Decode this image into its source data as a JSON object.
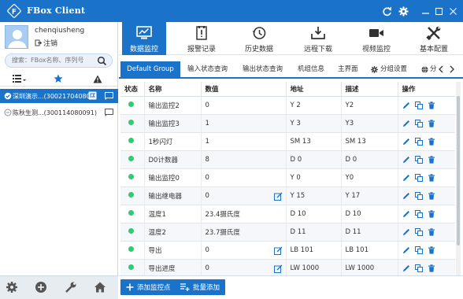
{
  "app": {
    "title": "FBox Client"
  },
  "user": {
    "name": "chenqiusheng",
    "logout_label": "注销"
  },
  "search": {
    "placeholder": "搜索：FBox名称、序列号"
  },
  "devices": [
    {
      "name": "深圳演示...(300217040800)",
      "online": true,
      "selected": true
    },
    {
      "name": "陈秋生测...(300114080091)",
      "online": false,
      "selected": false
    }
  ],
  "nav": {
    "tabs": [
      {
        "label": "数据监控",
        "icon": "monitor-icon",
        "active": true
      },
      {
        "label": "报警记录",
        "icon": "alarm-icon"
      },
      {
        "label": "历史数据",
        "icon": "history-icon"
      },
      {
        "label": "远程下载",
        "icon": "download-icon"
      },
      {
        "label": "视频监控",
        "icon": "video-icon"
      },
      {
        "label": "基本配置",
        "icon": "tools-icon"
      }
    ]
  },
  "groups": {
    "tabs": [
      "Default Group",
      "输入状态查询",
      "输出状态查询",
      "机组信息",
      "主界面",
      "分组设置",
      "分"
    ]
  },
  "table": {
    "headers": [
      "状态",
      "名称",
      "数值",
      "地址",
      "描述",
      "操作"
    ],
    "rows": [
      {
        "status": "online",
        "name": "输出监控2",
        "value": "0",
        "address": "Y 2",
        "desc": "Y2",
        "editable": false
      },
      {
        "status": "online",
        "name": "输出监控3",
        "value": "1",
        "address": "Y 3",
        "desc": "Y3",
        "editable": false
      },
      {
        "status": "online",
        "name": "1秒闪灯",
        "value": "1",
        "address": "SM 13",
        "desc": "SM 13",
        "editable": false
      },
      {
        "status": "online",
        "name": "D0计数器",
        "value": "8",
        "address": "D 0",
        "desc": "D 0",
        "editable": false
      },
      {
        "status": "online",
        "name": "输出监控0",
        "value": "0",
        "address": "Y 0",
        "desc": "Y0",
        "editable": false
      },
      {
        "status": "online",
        "name": "输出继电器",
        "value": "0",
        "address": "Y 15",
        "desc": "Y 17",
        "editable": true
      },
      {
        "status": "online",
        "name": "温度1",
        "value": "23.4摄氏度",
        "address": "D 10",
        "desc": "D 10",
        "editable": false
      },
      {
        "status": "online",
        "name": "温度2",
        "value": "23.7摄氏度",
        "address": "D 11",
        "desc": "D 11",
        "editable": false
      },
      {
        "status": "online",
        "name": "导出",
        "value": "0",
        "address": "LB 101",
        "desc": "LB 101",
        "editable": true
      },
      {
        "status": "online",
        "name": "导出进度",
        "value": "0",
        "address": "LW 1000",
        "desc": "LW 1000",
        "editable": true
      }
    ]
  },
  "actions": {
    "add_label": "添加监控点",
    "batch_label": "批量添加"
  },
  "colors": {
    "primary": "#1b73c9",
    "online": "#2ecc71",
    "offline": "#9aa3ad"
  }
}
